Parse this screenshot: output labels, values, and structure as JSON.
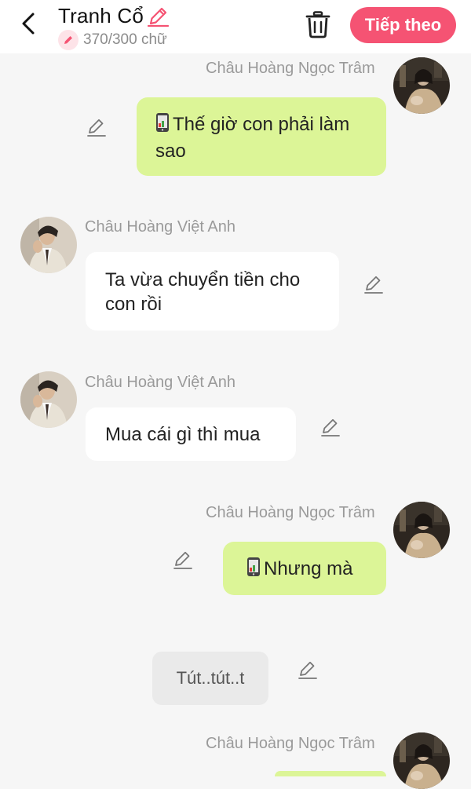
{
  "header": {
    "title": "Tranh Cổ",
    "word_count": "370/300 chữ",
    "next_label": "Tiếp theo",
    "accent_color": "#f55373"
  },
  "messages": [
    {
      "side": "right",
      "sender": "Châu Hoàng Ngọc Trâm",
      "icon": "phone-icon",
      "text": "Thế giờ con phải làm sao",
      "bubble_color": "#dcf597"
    },
    {
      "side": "left",
      "sender": "Châu Hoàng Việt Anh",
      "text": "Ta vừa chuyển tiền cho con rồi",
      "bubble_color": "#ffffff"
    },
    {
      "side": "left",
      "sender": "Châu Hoàng Việt Anh",
      "text": "Mua cái gì thì mua",
      "bubble_color": "#ffffff"
    },
    {
      "side": "right",
      "sender": "Châu Hoàng Ngọc Trâm",
      "icon": "phone-icon",
      "text": "Nhưng mà",
      "bubble_color": "#dcf597"
    },
    {
      "side": "center",
      "text": "Tút..tút..t",
      "bubble_color": "#eaeaea"
    },
    {
      "side": "right",
      "sender": "Châu Hoàng Ngọc Trâm",
      "text": "",
      "bubble_color": "#dcf597"
    }
  ]
}
